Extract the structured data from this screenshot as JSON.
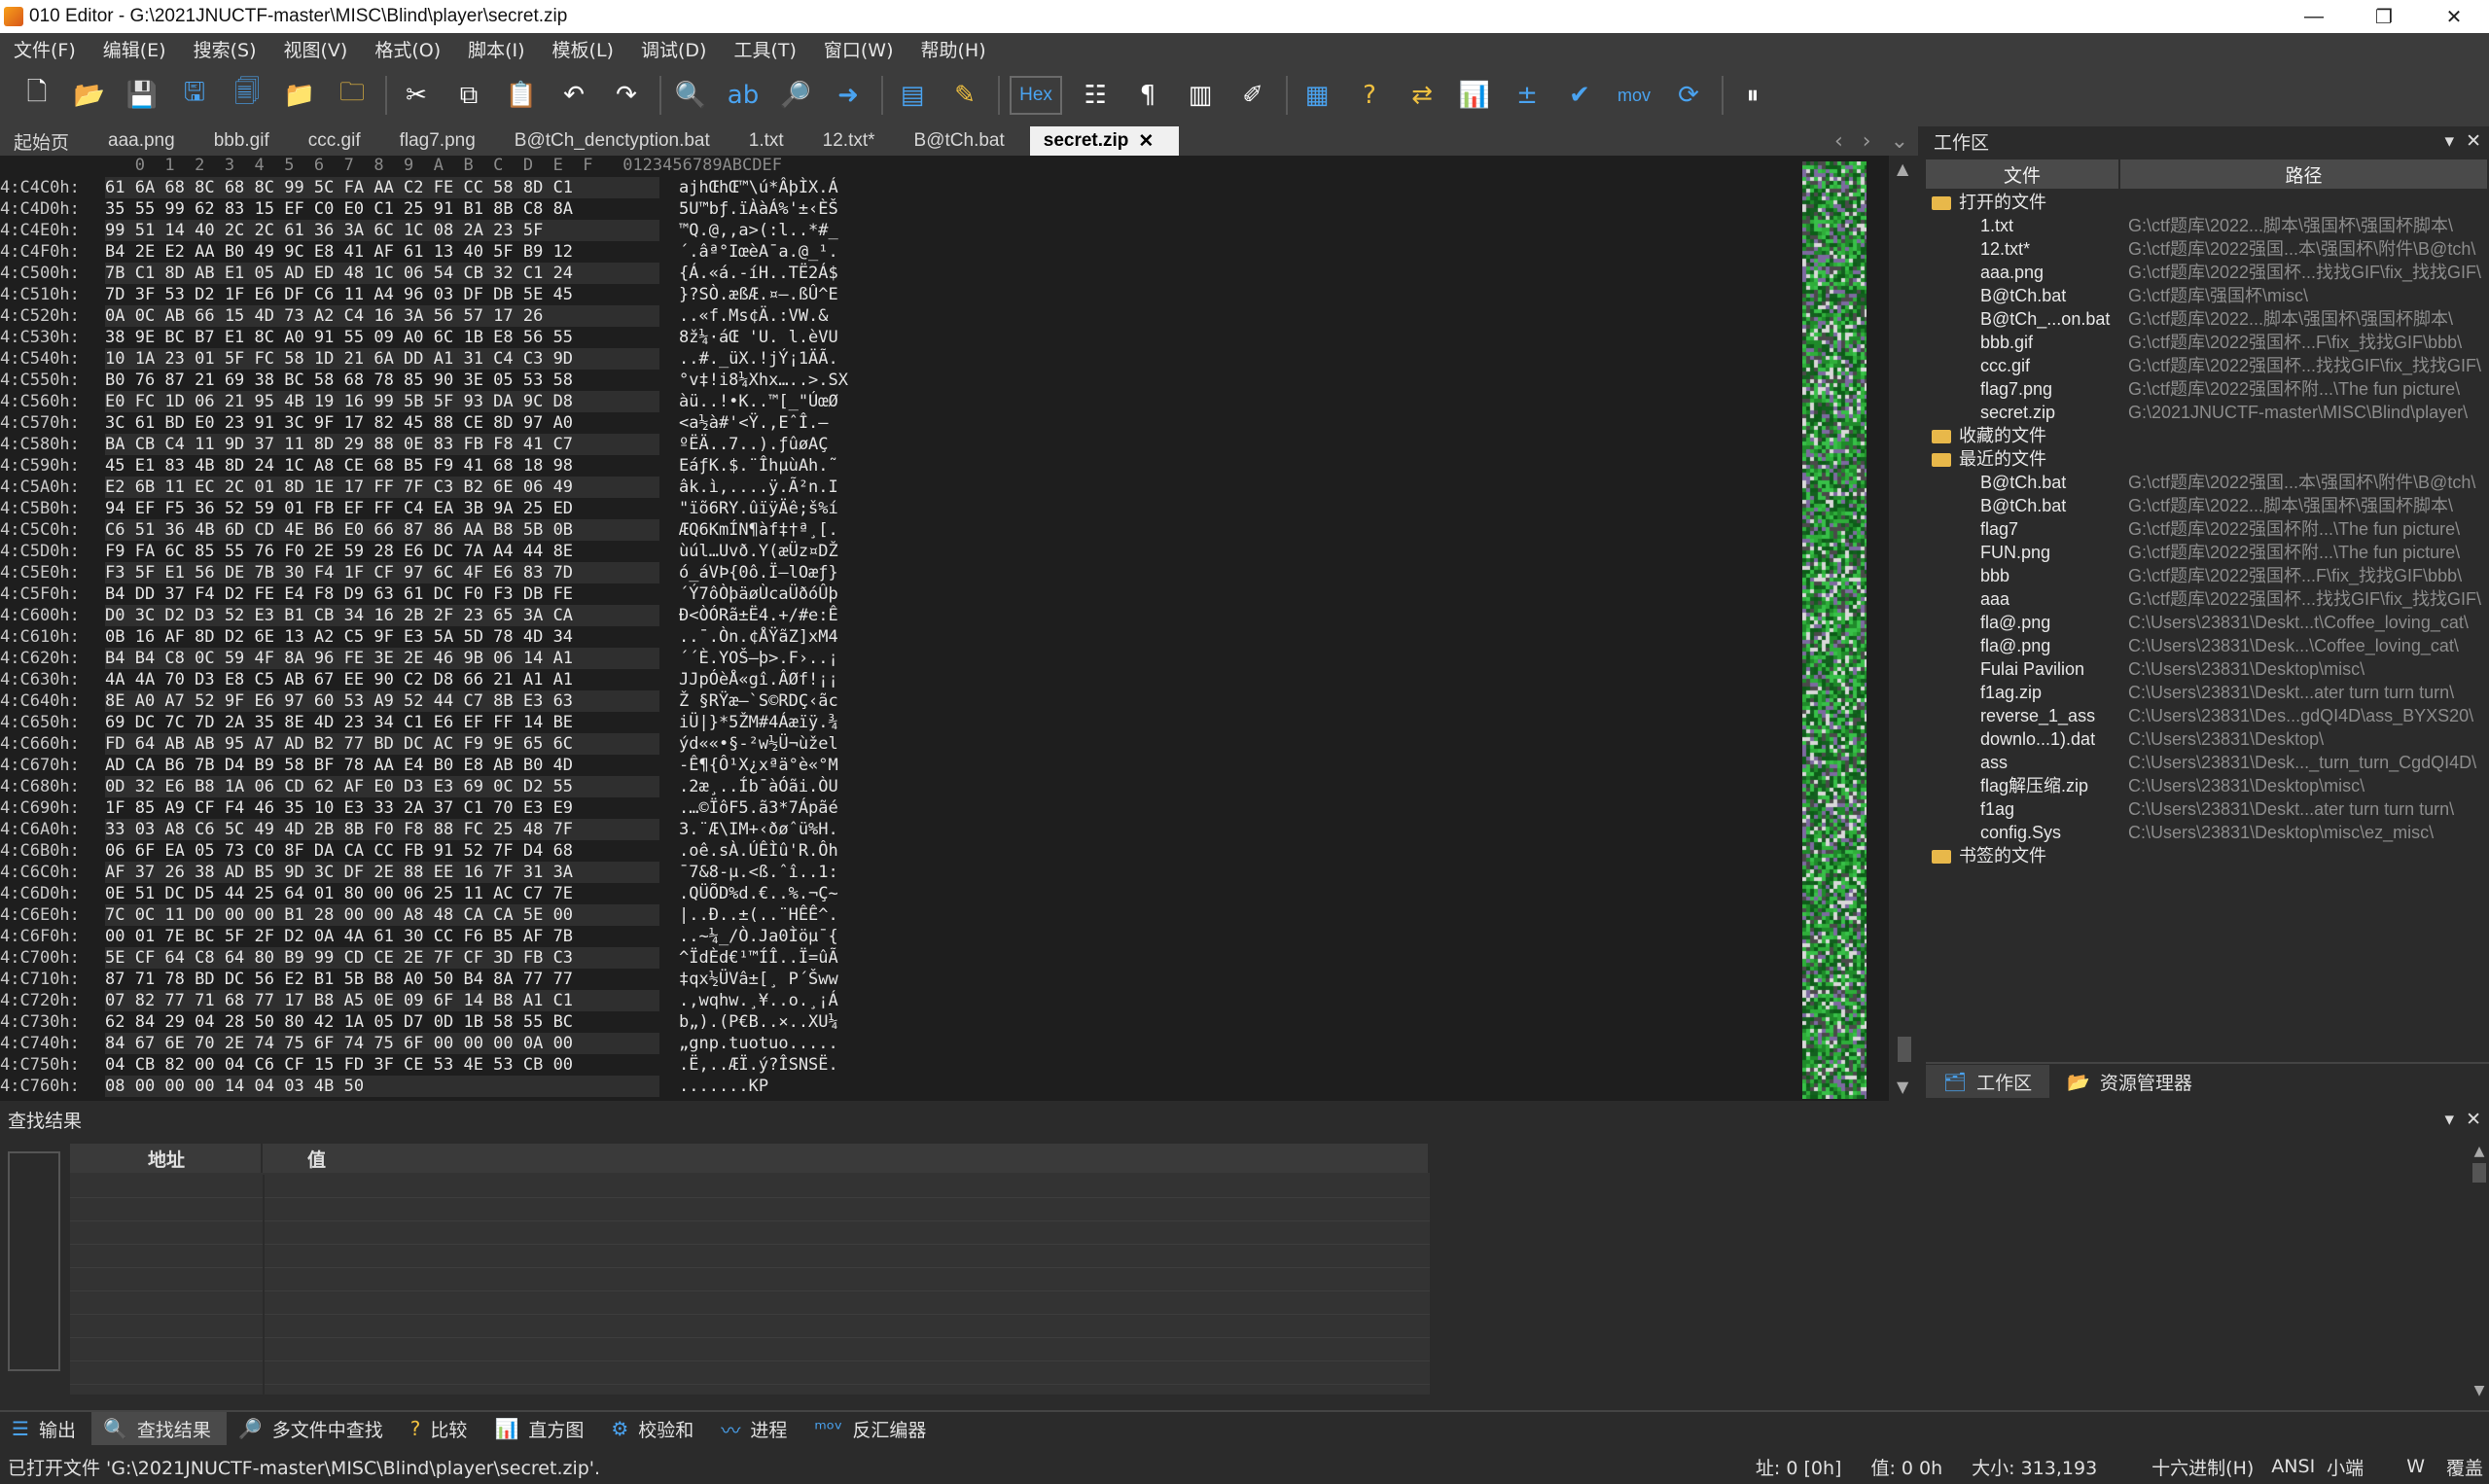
{
  "window": {
    "title": "010 Editor - G:\\2021JNUCTF-master\\MISC\\Blind\\player\\secret.zip",
    "minimize": "—",
    "maximize": "❐",
    "close": "✕"
  },
  "menu": [
    "文件(F)",
    "编辑(E)",
    "搜索(S)",
    "视图(V)",
    "格式(O)",
    "脚本(I)",
    "模板(L)",
    "调试(D)",
    "工具(T)",
    "窗口(W)",
    "帮助(H)"
  ],
  "toolbar": {
    "hex_label": "Hex",
    "mov_label": "mov",
    "icons": [
      "new-file-icon",
      "open-file-icon",
      "save-icon",
      "save-as-icon",
      "save-all-icon",
      "folder-icon",
      "open-folder-icon",
      "cut-icon",
      "copy-icon",
      "paste-icon",
      "undo-icon",
      "redo-icon",
      "find-icon",
      "replace-icon",
      "find-in-files-icon",
      "goto-icon",
      "template-icon",
      "script-icon",
      "hex-toggle",
      "edit-as-icon",
      "paragraph-icon",
      "columns-icon",
      "highlight-icon",
      "calculator-icon",
      "help-icon",
      "compare-icon",
      "histogram-icon",
      "checksum-icon",
      "run-icon",
      "mov-icon",
      "base-convert-icon",
      "pause-icon"
    ]
  },
  "tabs": [
    {
      "label": "起始页",
      "active": false
    },
    {
      "label": "aaa.png",
      "active": false
    },
    {
      "label": "bbb.gif",
      "active": false
    },
    {
      "label": "ccc.gif",
      "active": false
    },
    {
      "label": "flag7.png",
      "active": false
    },
    {
      "label": "B@tCh_denctyption.bat",
      "active": false
    },
    {
      "label": "1.txt",
      "active": false
    },
    {
      "label": "12.txt*",
      "active": false
    },
    {
      "label": "B@tCh.bat",
      "active": false
    },
    {
      "label": "secret.zip",
      "active": true
    }
  ],
  "hex": {
    "header": "   0  1  2  3  4  5  6  7  8  9  A  B  C  D  E  F   0123456789ABCDEF",
    "rows": [
      {
        "addr": "4:C4C0h:",
        "bytes": "61 6A 68 8C 68 8C 99 5C FA AA C2 FE CC 58 8D C1",
        "ascii": "ajhŒhŒ™\\ú*ÂþÌX.Á"
      },
      {
        "addr": "4:C4D0h:",
        "bytes": "35 55 99 62 83 15 EF C0 E0 C1 25 91 B1 8B C8 8A",
        "ascii": "5U™bƒ.ïÀàÁ%'±‹ÈŠ"
      },
      {
        "addr": "4:C4E0h:",
        "bytes": "99 51 14 40 2C 2C 61 36 3A 6C 1C 08 2A 23 5F",
        "ascii": "™Q.@,,a>(:l..*#_"
      },
      {
        "addr": "4:C4F0h:",
        "bytes": "B4 2E E2 AA B0 49 9C E8 41 AF 61 13 40 5F B9 12",
        "ascii": "´.âª°IœèA¯a.@_¹."
      },
      {
        "addr": "4:C500h:",
        "bytes": "7B C1 8D AB E1 05 AD ED 48 1C 06 54 CB 32 C1 24",
        "ascii": "{Á.«á.-íH..TË2Á$"
      },
      {
        "addr": "4:C510h:",
        "bytes": "7D 3F 53 D2 1F E6 DF C6 11 A4 96 03 DF DB 5E 45",
        "ascii": "}?SÒ.æßÆ.¤–.ßÛ^E"
      },
      {
        "addr": "4:C520h:",
        "bytes": "0A 0C AB 66 15 4D 73 A2 C4 16 3A 56 57 17 26",
        "ascii": "..«f.Ms¢Ä.:VW.&"
      },
      {
        "addr": "4:C530h:",
        "bytes": "38 9E BC B7 E1 8C A0 91 55 09 A0 6C 1B E8 56 55",
        "ascii": "8ž¼·áŒ 'U. l.èVU"
      },
      {
        "addr": "4:C540h:",
        "bytes": "10 1A 23 01 5F FC 58 1D 21 6A DD A1 31 C4 C3 9D",
        "ascii": "..#._üX.!jÝ¡1ÄÃ."
      },
      {
        "addr": "4:C550h:",
        "bytes": "B0 76 87 21 69 38 BC 58 68 78 85 90 3E 05 53 58",
        "ascii": "°v‡!i8¼Xhx…..>.SX"
      },
      {
        "addr": "4:C560h:",
        "bytes": "E0 FC 1D 06 21 95 4B 19 16 99 5B 5F 93 DA 9C D8",
        "ascii": "àü..!•K..™[_\"ÚœØ"
      },
      {
        "addr": "4:C570h:",
        "bytes": "3C 61 BD E0 23 91 3C 9F 17 82 45 88 CE 8D 97 A0",
        "ascii": "<a½à#'<Ÿ.‚EˆÎ.—"
      },
      {
        "addr": "4:C580h:",
        "bytes": "BA CB C4 11 9D 37 11 8D 29 88 0E 83 FB F8 41 C7",
        "ascii": "ºËÄ..7..).ƒûøAÇ"
      },
      {
        "addr": "4:C590h:",
        "bytes": "45 E1 83 4B 8D 24 1C A8 CE 68 B5 F9 41 68 18 98",
        "ascii": "EáƒK.$.¨ÎhµùAh.˜"
      },
      {
        "addr": "4:C5A0h:",
        "bytes": "E2 6B 11 EC 2C 01 8D 1E 17 FF 7F C3 B2 6E 06 49",
        "ascii": "âk.ì,....ÿ.Ã²n.I"
      },
      {
        "addr": "4:C5B0h:",
        "bytes": "94 EF F5 36 52 59 01 FB EF FF C4 EA 3B 9A 25 ED",
        "ascii": "\"ïõ6RY.ûïÿÄê;š%í"
      },
      {
        "addr": "4:C5C0h:",
        "bytes": "C6 51 36 4B 6D CD 4E B6 E0 66 87 86 AA B8 5B 0B",
        "ascii": "ÆQ6KmÍN¶àf‡†ª¸[."
      },
      {
        "addr": "4:C5D0h:",
        "bytes": "F9 FA 6C 85 55 76 F0 2E 59 28 E6 DC 7A A4 44 8E",
        "ascii": "ùúl…Uvð.Y(æÜz¤DŽ"
      },
      {
        "addr": "4:C5E0h:",
        "bytes": "F3 5F E1 56 DE 7B 30 F4 1F CF 97 6C 4F E6 83 7D",
        "ascii": "ó_áVÞ{0ô.Ï—lOæƒ}"
      },
      {
        "addr": "4:C5F0h:",
        "bytes": "B4 DD 37 F4 D2 FE E4 F8 D9 63 61 DC F0 F3 DB FE",
        "ascii": "´Ý7ôÒþäøÙcaÜðóÛþ"
      },
      {
        "addr": "4:C600h:",
        "bytes": "D0 3C D2 D3 52 E3 B1 CB 34 16 2B 2F 23 65 3A CA",
        "ascii": "Ð<ÒÓRã±Ë4.+/#e:Ê"
      },
      {
        "addr": "4:C610h:",
        "bytes": "0B 16 AF 8D D2 6E 13 A2 C5 9F E3 5A 5D 78 4D 34",
        "ascii": "..¯.Òn.¢ÅŸãZ]xM4"
      },
      {
        "addr": "4:C620h:",
        "bytes": "B4 B4 C8 0C 59 4F 8A 96 FE 3E 2E 46 9B 06 14 A1",
        "ascii": "´´È.YOŠ–þ>.F›..¡"
      },
      {
        "addr": "4:C630h:",
        "bytes": "4A 4A 70 D3 E8 C5 AB 67 EE 90 C2 D8 66 21 A1 A1",
        "ascii": "JJpÓèÅ«gî.ÂØf!¡¡"
      },
      {
        "addr": "4:C640h:",
        "bytes": "8E A0 A7 52 9F E6 97 60 53 A9 52 44 C7 8B E3 63",
        "ascii": "Ž §RŸæ—`S©RDÇ‹ãc"
      },
      {
        "addr": "4:C650h:",
        "bytes": "69 DC 7C 7D 2A 35 8E 4D 23 34 C1 E6 EF FF 14 BE",
        "ascii": "iÜ|}*5ŽM#4Áæïÿ.¾"
      },
      {
        "addr": "4:C660h:",
        "bytes": "FD 64 AB AB 95 A7 AD B2 77 BD DC AC F9 9E 65 6C",
        "ascii": "ýd««•§-²w½Ü¬ùžel"
      },
      {
        "addr": "4:C670h:",
        "bytes": "AD CA B6 7B D4 B9 58 BF 78 AA E4 B0 E8 AB B0 4D",
        "ascii": "-Ê¶{Ô¹X¿xªä°è«°M"
      },
      {
        "addr": "4:C680h:",
        "bytes": "0D 32 E6 B8 1A 06 CD 62 AF E0 D3 E3 69 0C D2 55",
        "ascii": ".2æ¸..Íb¯àÓãi.ÒU"
      },
      {
        "addr": "4:C690h:",
        "bytes": "1F 85 A9 CF F4 46 35 10 E3 33 2A 37 C1 70 E3 E9",
        "ascii": ".…©ÏôF5.ã3*7Ápãé"
      },
      {
        "addr": "4:C6A0h:",
        "bytes": "33 03 A8 C6 5C 49 4D 2B 8B F0 F8 88 FC 25 48 7F",
        "ascii": "3.¨Æ\\IM+‹ðøˆü%H."
      },
      {
        "addr": "4:C6B0h:",
        "bytes": "06 6F EA 05 73 C0 8F DA CA CC FB 91 52 7F D4 68",
        "ascii": ".oê.sÀ.ÚÊÌû'R.Ôh"
      },
      {
        "addr": "4:C6C0h:",
        "bytes": "AF 37 26 38 AD B5 9D 3C DF 2E 88 EE 16 7F 31 3A",
        "ascii": "¯7&8-µ.<ß.ˆî..1:"
      },
      {
        "addr": "4:C6D0h:",
        "bytes": "0E 51 DC D5 44 25 64 01 80 00 06 25 11 AC C7 7E",
        "ascii": ".QÜÕD%d.€..%.¬Ç~"
      },
      {
        "addr": "4:C6E0h:",
        "bytes": "7C 0C 11 D0 00 00 B1 28 00 00 A8 48 CA CA 5E 00",
        "ascii": "|..Ð..±(..¨HÊÊ^."
      },
      {
        "addr": "4:C6F0h:",
        "bytes": "00 01 7E BC 5F 2F D2 0A 4A 61 30 CC F6 B5 AF 7B",
        "ascii": "..~¼_/Ò.Ja0Ìöµ¯{"
      },
      {
        "addr": "4:C700h:",
        "bytes": "5E CF 64 C8 64 80 B9 99 CD CE 2E 7F CF 3D FB C3",
        "ascii": "^ÏdÈd€¹™ÍÎ..Ï=ûÃ"
      },
      {
        "addr": "4:C710h:",
        "bytes": "87 71 78 BD DC 56 E2 B1 5B B8 A0 50 B4 8A 77 77",
        "ascii": "‡qx½ÜVâ±[¸ P´Šww"
      },
      {
        "addr": "4:C720h:",
        "bytes": "07 82 77 71 68 77 17 B8 A5 0E 09 6F 14 B8 A1 C1",
        "ascii": ".‚wqhw.¸¥..o.¸¡Á"
      },
      {
        "addr": "4:C730h:",
        "bytes": "62 84 29 04 28 50 80 42 1A 05 D7 0D 1B 58 55 BC",
        "ascii": "b„).(P€B..×..XU¼"
      },
      {
        "addr": "4:C740h:",
        "bytes": "84 67 6E 70 2E 74 75 6F 74 75 6F 00 00 00 0A 00",
        "ascii": "„gnp.tuotuo....."
      },
      {
        "addr": "4:C750h:",
        "bytes": "04 CB 82 00 04 C6 CF 15 FD 3F CE 53 4E 53 CB 00",
        "ascii": ".Ë‚..ÆÏ.ý?ÎSNSË."
      },
      {
        "addr": "4:C760h:",
        "bytes": "08 00 00 00 14 04 03 4B 50",
        "ascii": ".......KP"
      }
    ]
  },
  "workspace": {
    "title": "工作区",
    "col_file": "文件",
    "col_path": "路径",
    "groups": [
      {
        "label": "打开的文件",
        "items": [
          {
            "name": "1.txt",
            "path": "G:\\ctf题库\\2022...脚本\\强国杯\\强国杯脚本\\"
          },
          {
            "name": "12.txt*",
            "path": "G:\\ctf题库\\2022强国...本\\强国杯\\附件\\B@tch\\"
          },
          {
            "name": "aaa.png",
            "path": "G:\\ctf题库\\2022强国杯...找找GIF\\fix_找找GIF\\"
          },
          {
            "name": "B@tCh.bat",
            "path": "G:\\ctf题库\\强国杯\\misc\\"
          },
          {
            "name": "B@tCh_...on.bat",
            "path": "G:\\ctf题库\\2022...脚本\\强国杯\\强国杯脚本\\"
          },
          {
            "name": "bbb.gif",
            "path": "G:\\ctf题库\\2022强国杯...F\\fix_找找GIF\\bbb\\"
          },
          {
            "name": "ccc.gif",
            "path": "G:\\ctf题库\\2022强国杯...找找GIF\\fix_找找GIF\\"
          },
          {
            "name": "flag7.png",
            "path": "G:\\ctf题库\\2022强国杯附...\\The fun picture\\"
          },
          {
            "name": "secret.zip",
            "path": "G:\\2021JNUCTF-master\\MISC\\Blind\\player\\"
          }
        ]
      },
      {
        "label": "收藏的文件",
        "items": []
      },
      {
        "label": "最近的文件",
        "items": [
          {
            "name": "B@tCh.bat",
            "path": "G:\\ctf题库\\2022强国...本\\强国杯\\附件\\B@tch\\"
          },
          {
            "name": "B@tCh.bat",
            "path": "G:\\ctf题库\\2022...脚本\\强国杯\\强国杯脚本\\"
          },
          {
            "name": "flag7",
            "path": "G:\\ctf题库\\2022强国杯附...\\The fun picture\\"
          },
          {
            "name": "FUN.png",
            "path": "G:\\ctf题库\\2022强国杯附...\\The fun picture\\"
          },
          {
            "name": "bbb",
            "path": "G:\\ctf题库\\2022强国杯...F\\fix_找找GIF\\bbb\\"
          },
          {
            "name": "aaa",
            "path": "G:\\ctf题库\\2022强国杯...找找GIF\\fix_找找GIF\\"
          },
          {
            "name": "fla@.png",
            "path": "C:\\Users\\23831\\Deskt...t\\Coffee_loving_cat\\"
          },
          {
            "name": "fla@.png",
            "path": "C:\\Users\\23831\\Desk...\\Coffee_loving_cat\\"
          },
          {
            "name": "Fulai Pavilion",
            "path": "C:\\Users\\23831\\Desktop\\misc\\"
          },
          {
            "name": "f1ag.zip",
            "path": "C:\\Users\\23831\\Deskt...ater turn turn turn\\"
          },
          {
            "name": "reverse_1_ass",
            "path": "C:\\Users\\23831\\Des...gdQI4D\\ass_BYXS20\\"
          },
          {
            "name": "downlo...1).dat",
            "path": "C:\\Users\\23831\\Desktop\\"
          },
          {
            "name": "ass",
            "path": "C:\\Users\\23831\\Desk..._turn_turn_CgdQI4D\\"
          },
          {
            "name": "flag解压缩.zip",
            "path": "C:\\Users\\23831\\Desktop\\misc\\"
          },
          {
            "name": "f1ag",
            "path": "C:\\Users\\23831\\Deskt...ater turn turn turn\\"
          },
          {
            "name": "config.Sys",
            "path": "C:\\Users\\23831\\Desktop\\misc\\ez_misc\\"
          }
        ]
      },
      {
        "label": "书签的文件",
        "items": []
      }
    ],
    "tab_workspace": "工作区",
    "tab_explorer": "资源管理器"
  },
  "find": {
    "title": "查找结果",
    "col_addr": "地址",
    "col_value": "值"
  },
  "bottom_tabs": [
    {
      "label": "输出",
      "active": false
    },
    {
      "label": "查找结果",
      "active": true
    },
    {
      "label": "多文件中查找",
      "active": false
    },
    {
      "label": "比较",
      "active": false
    },
    {
      "label": "直方图",
      "active": false
    },
    {
      "label": "校验和",
      "active": false
    },
    {
      "label": "进程",
      "active": false
    },
    {
      "label": "反汇编器",
      "active": false
    }
  ],
  "status": {
    "message": "已打开文件 'G:\\2021JNUCTF-master\\MISC\\Blind\\player\\secret.zip'.",
    "address": "址: 0 [0h]",
    "value": "值: 0 0h",
    "size": "大小: 313,193",
    "mode": "十六进制(H)",
    "encoding": "ANSI",
    "endian": "小端",
    "w": "W",
    "overwrite": "覆盖"
  }
}
